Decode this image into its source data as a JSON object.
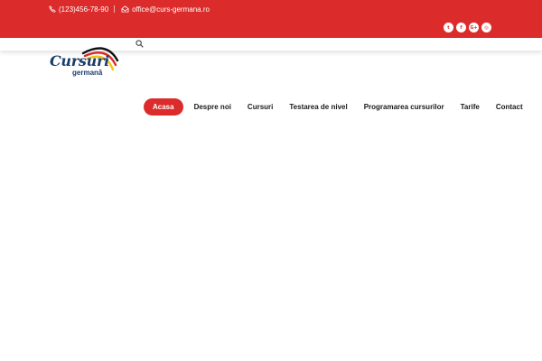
{
  "topbar": {
    "phone": "(123)456-78-90",
    "email": "office@curs-germana.ro",
    "social": [
      "twitter-icon",
      "facebook-icon",
      "google-plus-icon",
      "instagram-icon"
    ],
    "social_glyphs": [
      "t",
      "f",
      "G+",
      "◎"
    ]
  },
  "logo": {
    "title": "Cursuri",
    "subtitle": "germană"
  },
  "nav": {
    "items": [
      {
        "label": "Acasa",
        "active": true
      },
      {
        "label": "Despre noi"
      },
      {
        "label": "Cursuri"
      },
      {
        "label": "Testarea de nivel"
      },
      {
        "label": "Programarea cursurilor"
      },
      {
        "label": "Tarife"
      },
      {
        "label": "Contact"
      }
    ]
  },
  "colors": {
    "brand_red": "#dc2b2b",
    "logo_blue": "#1b3e6b",
    "flag": [
      "#111111",
      "#dc2b2b",
      "#f4c20d"
    ]
  }
}
